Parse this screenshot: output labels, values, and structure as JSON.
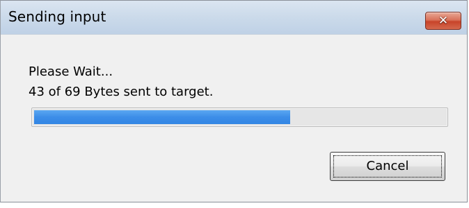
{
  "window": {
    "title": "Sending input",
    "close_glyph": "✕"
  },
  "message": {
    "line1": "Please Wait...",
    "line2": "43 of 69 Bytes sent to target."
  },
  "progress": {
    "sent": 43,
    "total": 69,
    "fill_color": "#3c8de8"
  },
  "buttons": {
    "cancel_label": "Cancel"
  },
  "colors": {
    "close_button": "#d9735b",
    "window_bg": "#f0f0f0",
    "titlebar": "#cbdaea"
  }
}
